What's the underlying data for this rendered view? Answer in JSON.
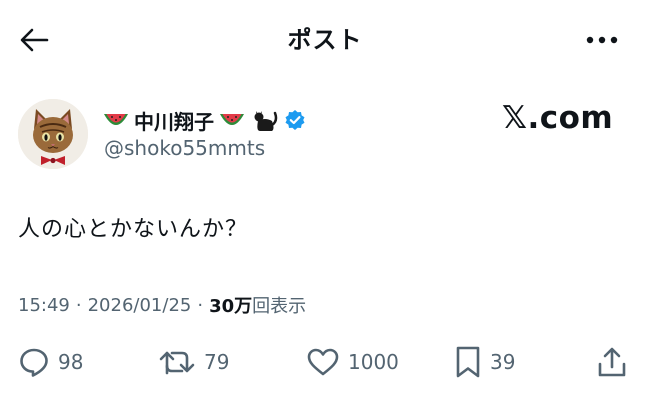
{
  "header": {
    "title": "ポスト",
    "back_icon": "back-arrow-icon",
    "more_icon": "more-horizontal-icon"
  },
  "author": {
    "display_name": "中川翔子",
    "handle": "@shoko55mmts",
    "verified": true,
    "verified_color": "#1d9bf0",
    "name_decorations": [
      "watermelon-emoji",
      "watermelon-emoji",
      "black-cat-emoji"
    ]
  },
  "watermark": "𝕏.com",
  "post": {
    "text": "人の心とかないんか？"
  },
  "meta": {
    "time": "15:49",
    "separator": "·",
    "date": "2026/01/25",
    "views_count": "30万",
    "views_label": "回表示"
  },
  "actions": {
    "replies": "98",
    "reposts": "79",
    "likes": "1000",
    "bookmarks": "39"
  },
  "colors": {
    "text": "#0f1419",
    "secondary": "#536471",
    "accent": "#1d9bf0"
  }
}
